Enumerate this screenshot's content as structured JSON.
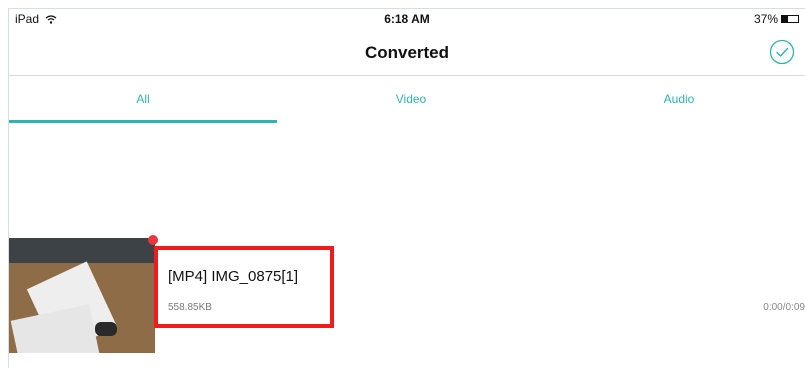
{
  "status_bar": {
    "device": "iPad",
    "time": "6:18 AM",
    "battery": "37%",
    "battery_level": 0.37
  },
  "nav": {
    "title": "Converted",
    "select_icon": "checkmark-circle-icon"
  },
  "tabs": [
    {
      "label": "All",
      "selected": true
    },
    {
      "label": "Video",
      "selected": false
    },
    {
      "label": "Audio",
      "selected": false
    }
  ],
  "files": [
    {
      "name": "[MP4] IMG_0875[1]",
      "size": "558.85KB",
      "duration": "0:00/0:09",
      "new_indicator": true
    }
  ],
  "colors": {
    "accent": "#2fb3b0",
    "highlight": "#ee1c1c",
    "new_dot": "#e8363c"
  }
}
